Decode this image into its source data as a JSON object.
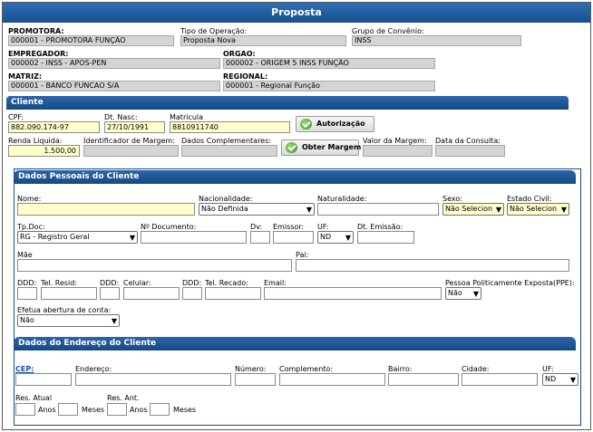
{
  "title": "Proposta",
  "promotora": {
    "label": "PROMOTORA:",
    "value": "000001 - PROMOTORA FUNÇÃO"
  },
  "tipo_operacao": {
    "label": "Tipo de Operação:",
    "value": "Proposta Nova"
  },
  "grupo_convenio": {
    "label": "Grupo de Convênio:",
    "value": "INSS"
  },
  "empregador": {
    "label": "EMPREGADOR:",
    "value": "000002 - INSS - APOS-PEN"
  },
  "orgao": {
    "label": "ORGAO:",
    "value": "000002 - ORIGEM 5 INSS FUNÇÃO"
  },
  "matriz": {
    "label": "MATRIZ:",
    "value": "000001 - BANCO FUNCAO S/A"
  },
  "regional": {
    "label": "REGIONAL:",
    "value": "000001 - Regional Função"
  },
  "cliente": {
    "section_title": "Cliente",
    "cpf_label": "CPF:",
    "cpf": "882.090.174-97",
    "dt_nasc_label": "Dt. Nasc:",
    "dt_nasc": "27/10/1991",
    "matricula_label": "Matricula",
    "matricula": "8810911740",
    "autorizacao_button": "Autorização",
    "renda_label": "Renda Liquida:",
    "renda": "1.500,00",
    "ident_margem_label": "Identificador de Margem:",
    "dados_compl_label": "Dados Complementares:",
    "obter_margem_button": "Obter Margem",
    "valor_margem_label": "Valor da Margem:",
    "data_consulta_label": "Data da Consulta:"
  },
  "dados_pessoais": {
    "section_title": "Dados Pessoais do Cliente",
    "nome_label": "Nome:",
    "nacionalidade_label": "Nacionalidade:",
    "nacionalidade": "Não Definida",
    "naturalidade_label": "Naturalidade:",
    "sexo_label": "Sexo:",
    "sexo": "Não Selecion",
    "estado_civil_label": "Estado Civil:",
    "estado_civil": "Não Selecion",
    "tp_doc_label": "Tp.Doc:",
    "tp_doc": "RG - Registro Geral",
    "n_documento_label": "Nº Documento:",
    "dv_label": "Dv:",
    "emissor_label": "Emissor:",
    "uf_label": "UF:",
    "uf": "ND",
    "dt_emissao_label": "Dt. Emissão:",
    "mae_label": "Mãe",
    "pai_label": "Pai:",
    "ddd_label": "DDD:",
    "tel_resid_label": "Tel. Resid:",
    "celular_label": "Celular:",
    "tel_recado_label": "Tel. Recado:",
    "email_label": "Email:",
    "ppe_label": "Pessoa Politicamente Exposta(PPE):",
    "ppe": "Não",
    "abertura_conta_label": "Efetua abertura de conta:",
    "abertura_conta": "Não"
  },
  "endereco": {
    "section_title": "Dados do Endereço do Cliente",
    "cep_label": "CEP:",
    "endereco_label": "Endereço:",
    "numero_label": "Número:",
    "complemento_label": "Complemento:",
    "bairro_label": "Bairro:",
    "cidade_label": "Cidade:",
    "uf_label": "UF:",
    "uf": "ND",
    "res_atual_label": "Res. Atual",
    "res_ant_label": "Res. Ant.",
    "anos_label": "Anos",
    "meses_label": "Meses"
  }
}
